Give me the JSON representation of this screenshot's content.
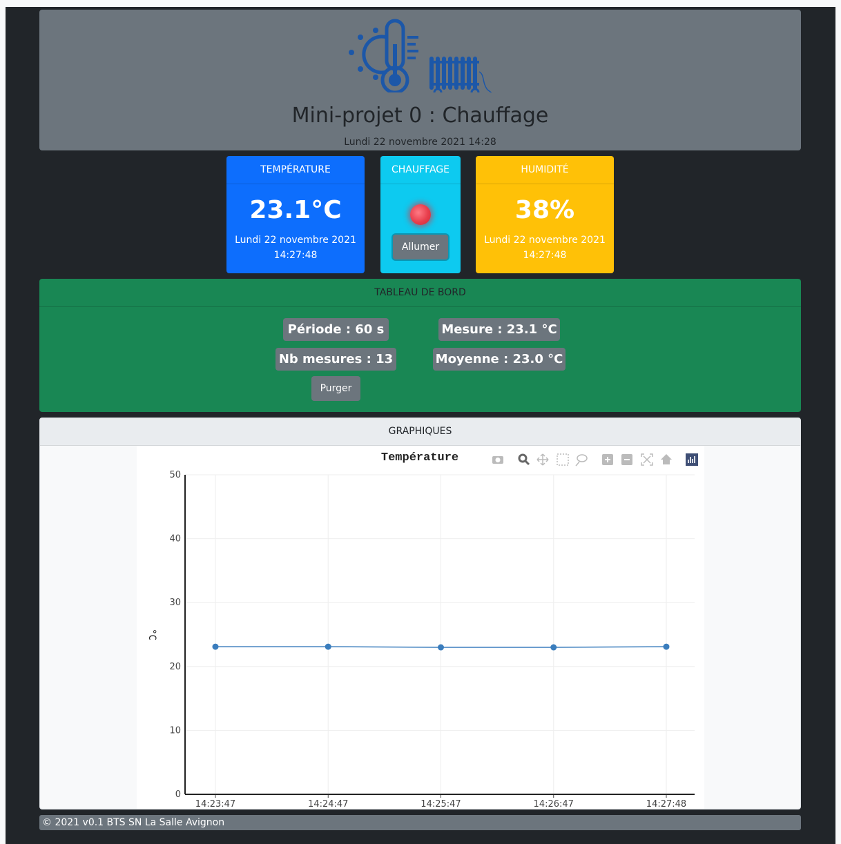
{
  "header": {
    "title": "Mini-projet 0 : Chauffage",
    "date": "Lundi 22 novembre 2021 14:28"
  },
  "cards": {
    "temperature": {
      "title": "TEMPÉRATURE",
      "value": "23.1°C",
      "date": "Lundi 22 novembre 2021",
      "time": "14:27:48"
    },
    "heating": {
      "title": "CHAUFFAGE",
      "button": "Allumer",
      "state": "off"
    },
    "humidity": {
      "title": "HUMIDITÉ",
      "value": "38%",
      "date": "Lundi 22 novembre 2021",
      "time": "14:27:48"
    }
  },
  "dashboard": {
    "title": "TABLEAU DE BORD",
    "period": "Période : 60 s",
    "measure": "Mesure : 23.1 °C",
    "count": "Nb mesures : 13",
    "average": "Moyenne : 23.0 °C",
    "purge": "Purger"
  },
  "graphs": {
    "title": "GRAPHIQUES"
  },
  "footer": {
    "text": "© 2021 v0.1 BTS SN La Salle Avignon"
  },
  "colors": {
    "primary": "#0d6efd",
    "info": "#0dcaf0",
    "warning": "#ffc107",
    "success": "#198754",
    "secondary": "#6c757d",
    "dark": "#212529",
    "line": "#3a7dbd",
    "icon": "#1c57a8"
  },
  "toolbar_icons": [
    "camera-icon",
    "zoom-icon",
    "pan-icon",
    "box-select-icon",
    "lasso-icon",
    "zoom-in-icon",
    "zoom-out-icon",
    "autoscale-icon",
    "reset-axes-icon",
    "plotly-logo-icon"
  ],
  "chart_data": {
    "type": "line",
    "title": "Température",
    "xlabel": "",
    "ylabel": "°C",
    "x": [
      "14:23:47",
      "14:24:47",
      "14:25:47",
      "14:26:47",
      "14:27:48"
    ],
    "series": [
      {
        "values": [
          23.1,
          23.1,
          23.0,
          23.0,
          23.1
        ]
      }
    ],
    "xtick_labels": [
      "14:23:47",
      "14:24:47",
      "14:25:47",
      "14:26:47",
      "14:27:48"
    ],
    "yticks": [
      0,
      10,
      20,
      30,
      40,
      50
    ],
    "ylim": [
      0,
      50
    ],
    "grid": true
  }
}
